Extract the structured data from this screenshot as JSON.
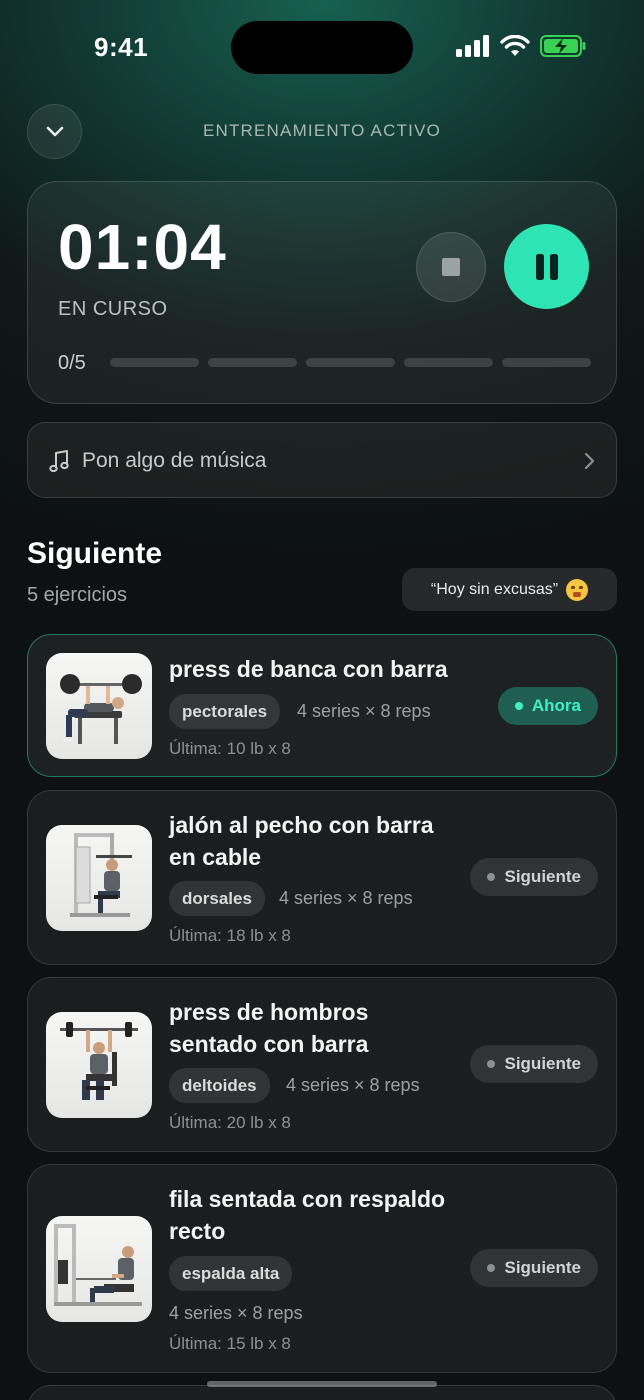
{
  "status_bar": {
    "time": "9:41"
  },
  "header": {
    "title": "ENTRENAMIENTO ACTIVO"
  },
  "timer": {
    "elapsed": "01:04",
    "status": "EN CURSO",
    "progress_label": "0/5",
    "completed": 0,
    "total": 5
  },
  "music": {
    "label": "Pon algo de música"
  },
  "section": {
    "title": "Siguiente",
    "subtitle": "5 ejercicios",
    "motto": "“Hoy sin excusas”"
  },
  "exercises": [
    {
      "name": "press de banca con barra",
      "muscle": "pectorales",
      "sets": "4 series × 8 reps",
      "last": "Última: 10 lb x 8",
      "status": "Ahora"
    },
    {
      "name": "jalón al pecho con barra en cable",
      "muscle": "dorsales",
      "sets": "4 series × 8 reps",
      "last": "Última: 18 lb x 8",
      "status": "Siguiente"
    },
    {
      "name": "press de hombros sentado con barra",
      "muscle": "deltoides",
      "sets": "4 series × 8 reps",
      "last": "Última: 20 lb x 8",
      "status": "Siguiente"
    },
    {
      "name": "fila sentada con respaldo recto",
      "muscle": "espalda alta",
      "sets": "4 series × 8 reps",
      "last": "Última: 15 lb x 8",
      "status": "Siguiente"
    }
  ],
  "colors": {
    "accent": "#2ee3b4",
    "background": "#0f1a19"
  },
  "icons": [
    "chevron-down-icon",
    "stop-icon",
    "pause-icon",
    "music-note-icon",
    "chevron-right-icon",
    "signal-icon",
    "wifi-icon",
    "battery-charging-icon"
  ]
}
